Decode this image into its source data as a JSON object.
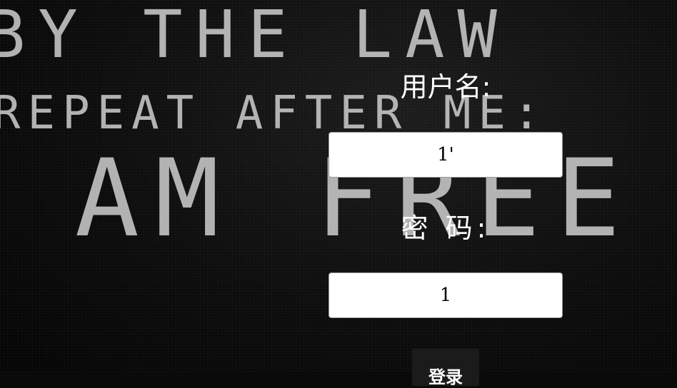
{
  "background": {
    "line1": "BY THE LAW",
    "line2": "REPEAT AFTER ME:",
    "line3": "I AM FREE"
  },
  "login_form": {
    "username_label": "用户名:",
    "username_value": "1'",
    "password_label": "密 码:",
    "password_value": "1",
    "submit_label": "登录"
  }
}
